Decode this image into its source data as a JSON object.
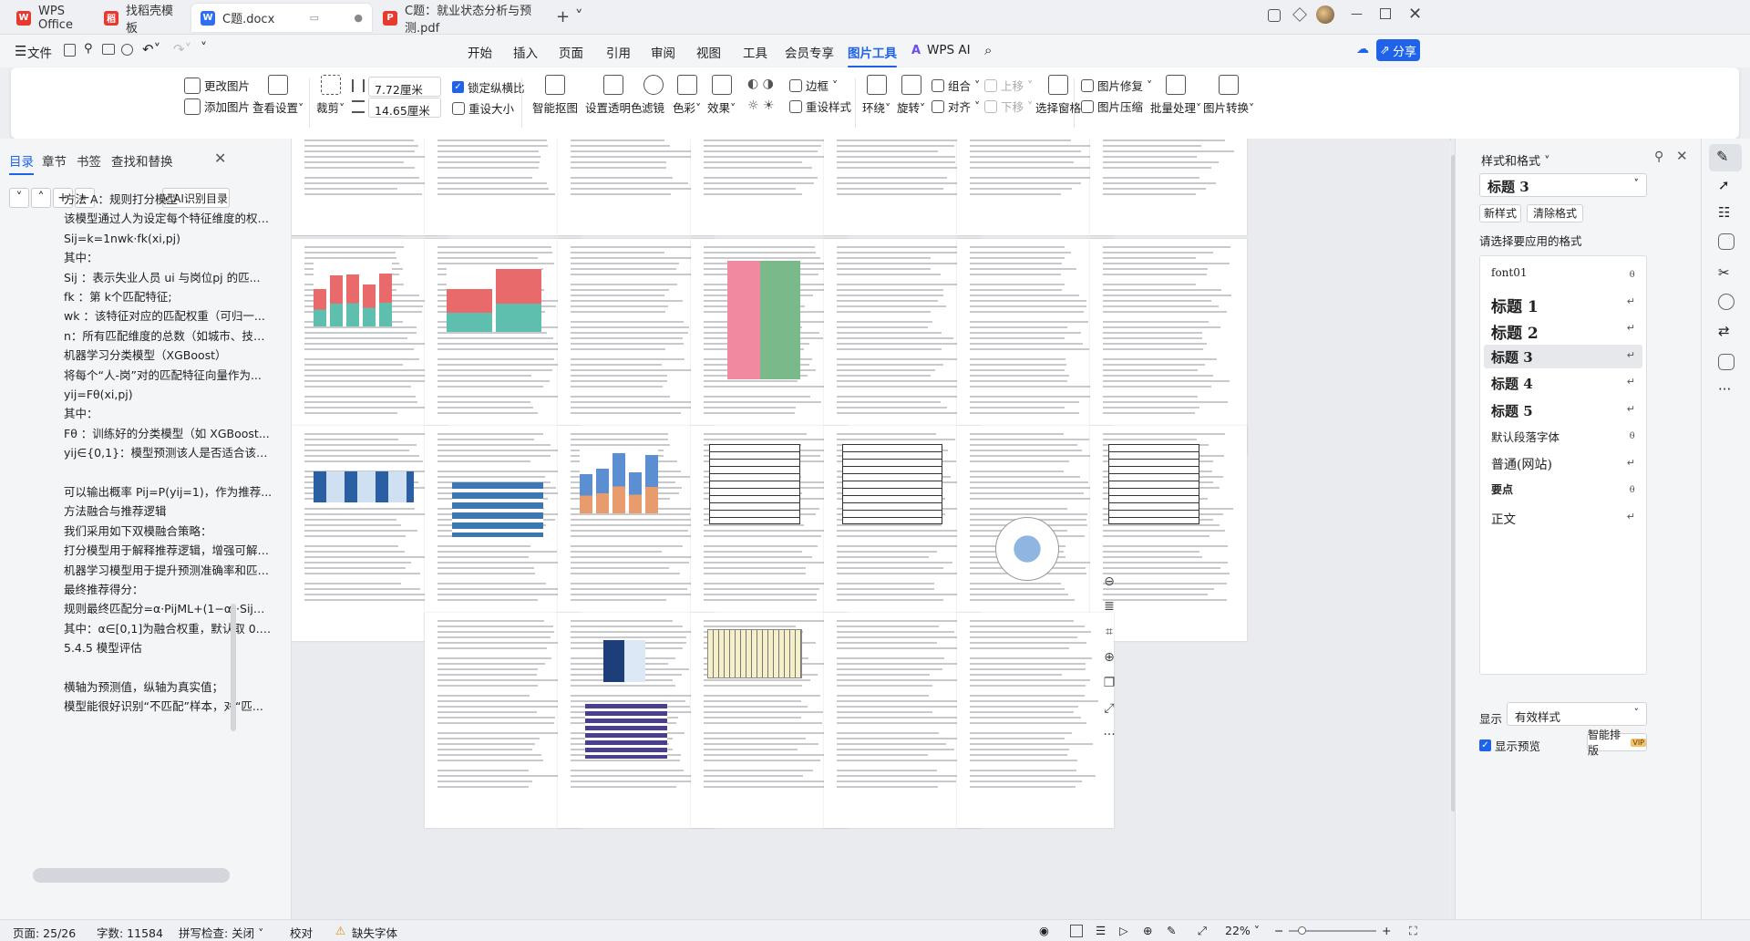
{
  "tabs": [
    {
      "label": "WPS Office",
      "icon": "wps-logo-icon"
    },
    {
      "label": "找稻壳模板",
      "icon": "docer-icon"
    },
    {
      "label": "C题.docx",
      "icon": "word-doc-icon"
    },
    {
      "label": "C题：就业状态分析与预测.pdf",
      "icon": "pdf-icon"
    }
  ],
  "menubar": {
    "file": "文件",
    "items": [
      "开始",
      "插入",
      "页面",
      "引用",
      "审阅",
      "视图",
      "工具",
      "会员专享",
      "图片工具",
      "WPS AI"
    ],
    "active": "图片工具",
    "share": "分享"
  },
  "ribbon": {
    "change_picture": "更改图片",
    "add_picture": "添加图片",
    "view_settings": "查看设置",
    "crop": "裁剪",
    "width_value": "7.72厘米",
    "height_value": "14.65厘米",
    "lock_ratio": "锁定纵横比",
    "reset_size": "重设大小",
    "smart_cutout": "智能抠图",
    "set_transparent": "设置透明色",
    "filter": "滤镜",
    "color": "色彩",
    "effects": "效果",
    "border": "边框",
    "reset_style": "重设样式",
    "wrap": "环绕",
    "rotate": "旋转",
    "group": "组合",
    "align": "对齐",
    "bring_up": "上移",
    "send_down": "下移",
    "selection_pane": "选择窗格",
    "repair": "图片修复",
    "compress": "图片压缩",
    "batch": "批量处理",
    "convert": "图片转换"
  },
  "leftpanel": {
    "tabs": [
      "目录",
      "章节",
      "书签",
      "查找和替换"
    ],
    "ai_toc": "AI识别目录",
    "toc": [
      "方法 A：规则打分模型",
      "该模型通过人为设定每个特征维度的权重...",
      "Sij=k=1nwk·fk(xi,pj)",
      "其中：",
      "Sij ：表示失业人员 ui 与岗位pj 的匹...",
      "fk ：第 k个匹配特征;",
      "wk ：该特征对应的匹配权重（可归一...",
      "n：所有匹配维度的总数（如城市、技能...",
      "机器学习分类模型（XGBoost）",
      "将每个“人-岗”对的匹配特征向量作为...",
      "yij=Fθ(xi,pj)",
      "其中：",
      "Fθ ：训练好的分类模型（如 XGBoost...",
      "yij∈{0,1}：模型预测该人是否适合该岗位...",
      "",
      "可以输出概率 Pij=P(yij=1)，作为推荐...",
      "方法融合与推荐逻辑",
      "我们采用如下双模融合策略：",
      "打分模型用于解释推荐逻辑，增强可解释...",
      "机器学习模型用于提升预测准确率和匹配...",
      "最终推荐得分：",
      "规则最终匹配分=α·PijML+(1−α)·Sij规...",
      "其中：α∈[0,1]为融合权重，默认取 0.7...",
      "5.4.5 模型评估",
      "",
      "横轴为预测值，纵轴为真实值；",
      "模型能很好识别“不匹配”样本，对“匹..."
    ]
  },
  "rightpanel": {
    "title": "样式和格式",
    "current_style": "标题 3",
    "new_style": "新样式",
    "clear_format": "清除格式",
    "prompt": "请选择要应用的格式",
    "styles": [
      "font01",
      "标题 1",
      "标题 2",
      "标题 3",
      "标题 4",
      "标题 5",
      "默认段落字体",
      "普通(网站)",
      "要点",
      "正文"
    ],
    "show_label": "显示",
    "show_value": "有效样式",
    "preview": "显示预览",
    "smart_layout": "智能排版",
    "vip": "VIP"
  },
  "statusbar": {
    "page": "页面: 25/26",
    "words": "字数: 11584",
    "spell": "拼写检查: 关闭",
    "proof": "校对",
    "missing_font": "缺失字体",
    "zoom": "22%"
  },
  "colors": {
    "accent": "#1e63e9",
    "wps_red": "#e8392f"
  }
}
